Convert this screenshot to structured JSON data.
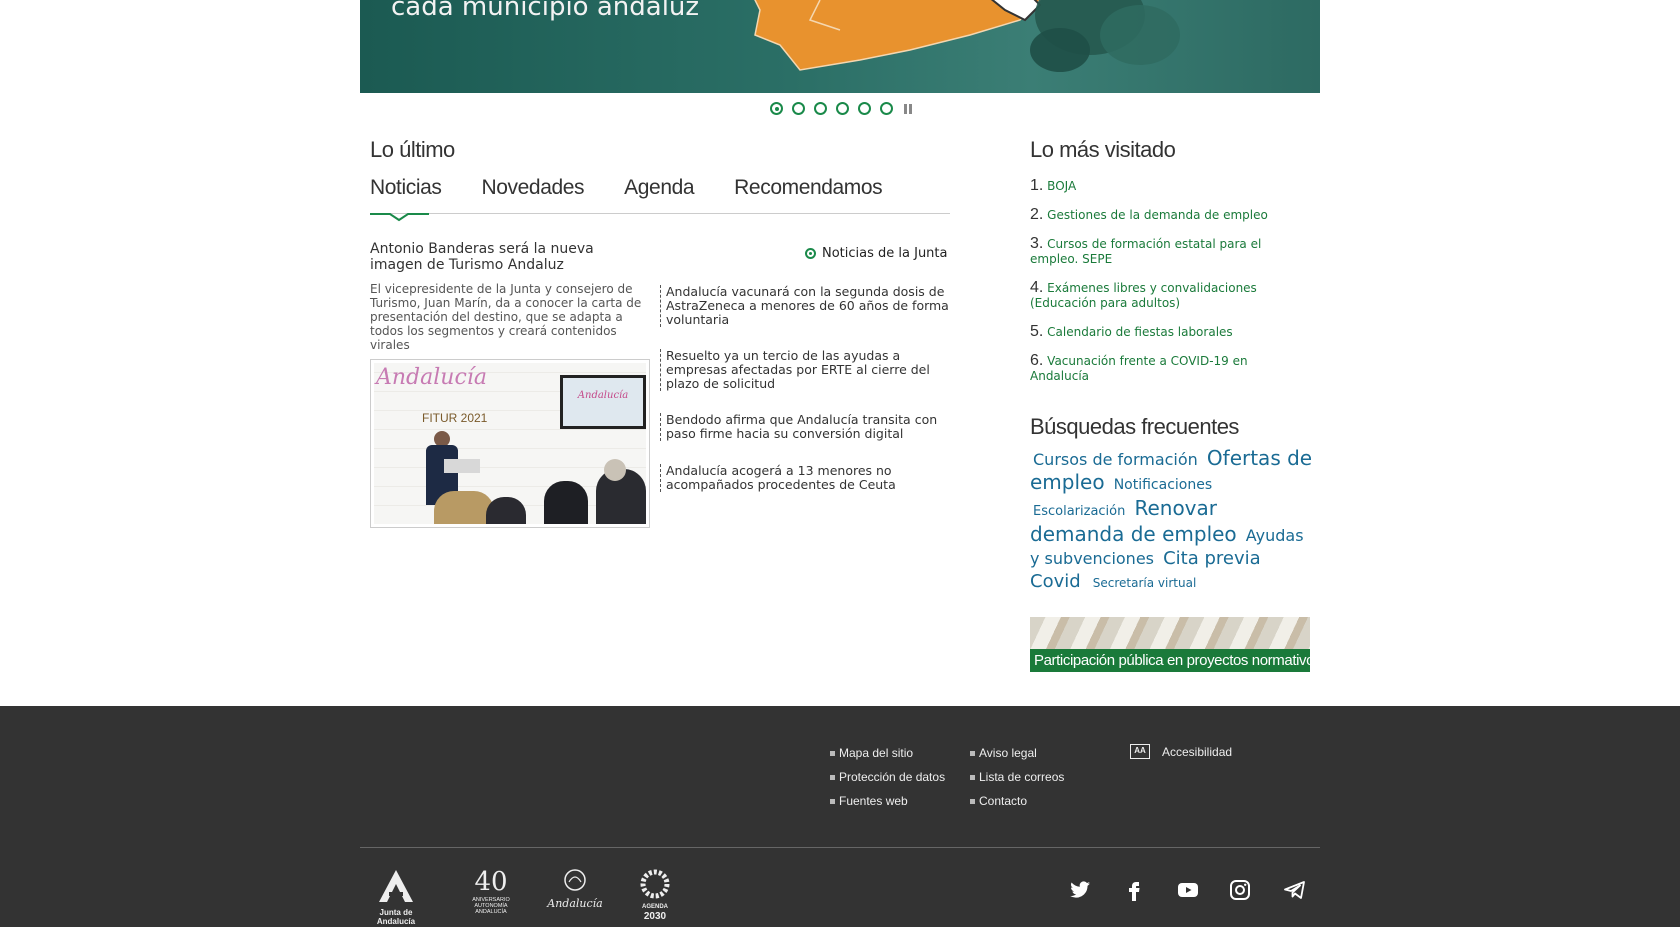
{
  "hero": {
    "caption": "cada municipio andaluz",
    "slide_count": 6,
    "active_slide": 1
  },
  "lo_ultimo": {
    "title": "Lo último",
    "tabs": [
      {
        "label": "Noticias",
        "active": true
      },
      {
        "label": "Novedades",
        "active": false
      },
      {
        "label": "Agenda",
        "active": false
      },
      {
        "label": "Recomendamos",
        "active": false
      }
    ],
    "featured": {
      "title": "Antonio Banderas será la nueva imagen de Turismo Andaluz",
      "description": "El vicepresidente de la Junta y consejero de Turismo, Juan Marín, da a conocer la carta de presentación del destino, que se adapta a todos los segmentos y creará contenidos virales",
      "image_text": {
        "brand": "Andalucía",
        "event": "FITUR 2021",
        "screen": "Andalucía"
      }
    },
    "junta_link": "Noticias de la Junta",
    "news": [
      "Andalucía vacunará con la segunda dosis de AstraZeneca a menores de 60 años de forma voluntaria",
      "Resuelto ya un tercio de las ayudas a empresas afectadas por ERTE al cierre del plazo de solicitud",
      "Bendodo afirma que Andalucía transita con paso firme hacia su conversión digital",
      "Andalucía acogerá a 13 menores no acompañados procedentes de Ceuta"
    ]
  },
  "mas_visitado": {
    "title": "Lo más visitado",
    "items": [
      {
        "num": "1.",
        "label": "BOJA"
      },
      {
        "num": "2.",
        "label": "Gestiones de la demanda de empleo"
      },
      {
        "num": "3.",
        "label": "Cursos de formación estatal para el empleo. SEPE"
      },
      {
        "num": "4.",
        "label": "Exámenes libres y convalidaciones (Educación para adultos)"
      },
      {
        "num": "5.",
        "label": "Calendario de fiestas laborales"
      },
      {
        "num": "6.",
        "label": "Vacunación frente a COVID-19 en Andalucía"
      }
    ]
  },
  "busquedas": {
    "title": "Búsquedas frecuentes",
    "tags": [
      {
        "label": "Cursos de formación",
        "size": "md"
      },
      {
        "label": "Ofertas de empleo",
        "size": "lg"
      },
      {
        "label": "Notificaciones",
        "size": "sm"
      },
      {
        "label": "Escolarización",
        "size": "xs"
      },
      {
        "label": "Renovar demanda de empleo",
        "size": "lg"
      },
      {
        "label": "Ayudas y subvenciones",
        "size": "sm"
      },
      {
        "label": "Cita previa",
        "size": "md"
      },
      {
        "label": "Covid",
        "size": "md"
      },
      {
        "label": "Secretaría virtual",
        "size": "xs"
      }
    ]
  },
  "participa_banner": "Participación pública en proyectos normativos",
  "footer": {
    "links_col1": [
      "Mapa del sitio",
      "Protección de datos",
      "Fuentes web"
    ],
    "links_col2": [
      "Aviso legal",
      "Lista de correos",
      "Contacto"
    ],
    "accessibility": "Accesibilidad",
    "accessibility_icon_text": "AA",
    "logos": {
      "junta": "Junta de Andalucía",
      "aniversario_num": "40",
      "aniversario_text": "ANIVERSARIO AUTONOMÍA ANDALUCÍA",
      "andalucia": "Andalucía",
      "agenda": "AGENDA",
      "agenda_year": "2030"
    },
    "social": [
      "twitter-icon",
      "facebook-icon",
      "youtube-icon",
      "instagram-icon",
      "telegram-icon"
    ]
  },
  "colors": {
    "accent_green": "#1a8a4a",
    "link_green": "#1a7a3a",
    "tag_blue": "#1a6b94",
    "footer_bg": "#333333",
    "map_orange": "#e8922e"
  }
}
